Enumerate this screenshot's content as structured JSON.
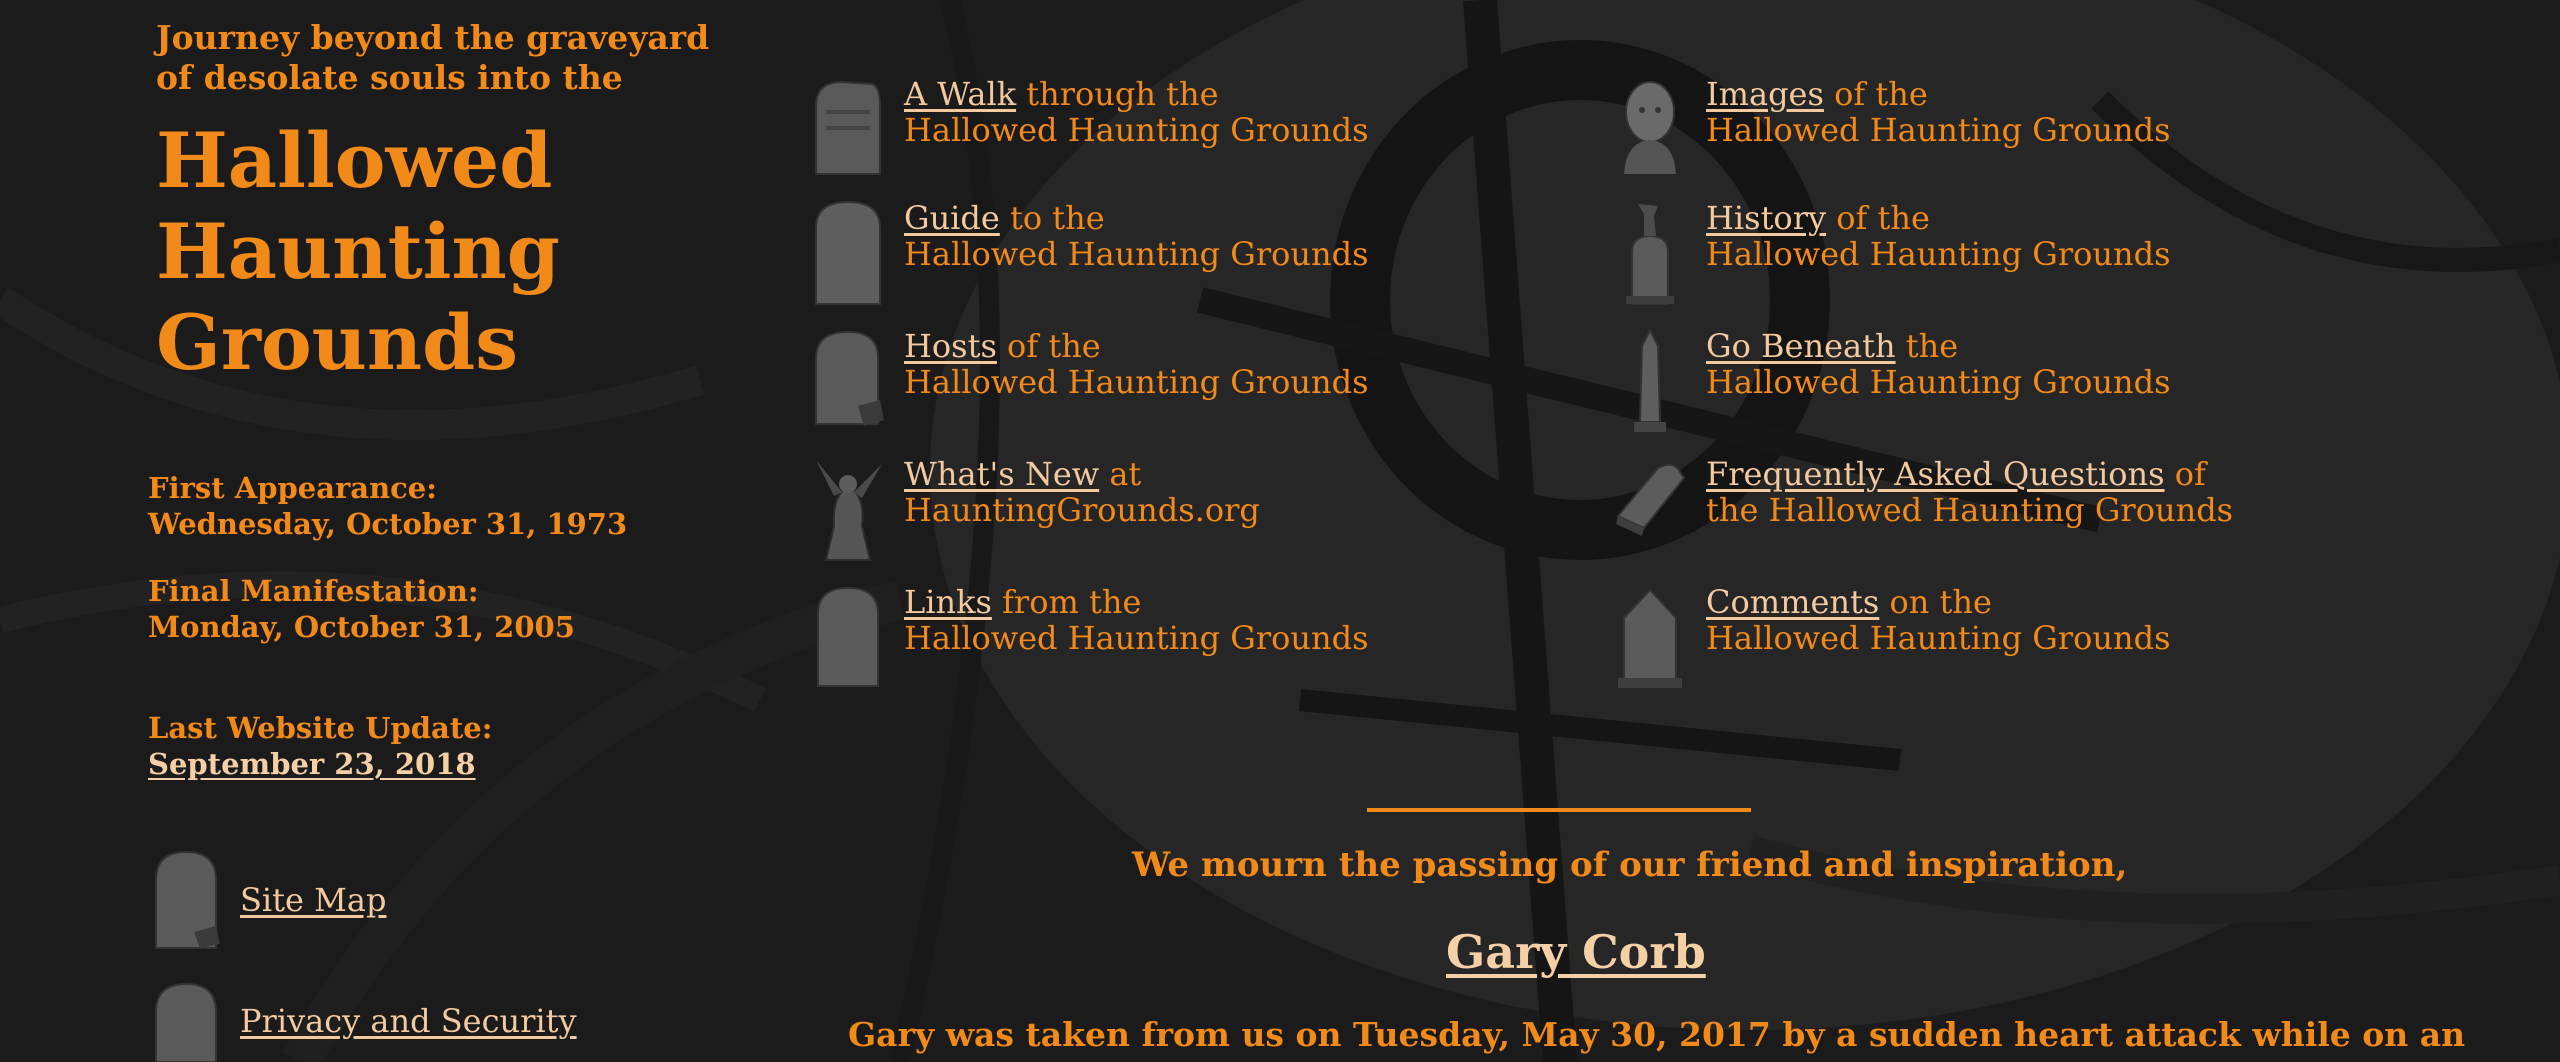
{
  "intro": {
    "line1": "Journey beyond the graveyard",
    "line2": "of desolate souls into the"
  },
  "title": {
    "line1": "Hallowed",
    "line2": "Haunting",
    "line3": "Grounds"
  },
  "dates": {
    "first_label": "First Appearance:",
    "first_value": "Wednesday, October 31, 1973",
    "final_label": "Final Manifestation:",
    "final_value": "Monday, October 31, 2005",
    "update_label": "Last Website Update:",
    "update_value": "September 23, 2018"
  },
  "side_links": {
    "sitemap": "Site Map",
    "privacy": "Privacy and Security"
  },
  "nav": {
    "walk": {
      "link": "A Walk",
      "rest": " through the",
      "line2": "Hallowed Haunting Grounds"
    },
    "guide": {
      "link": "Guide",
      "rest": " to the",
      "line2": "Hallowed Haunting Grounds"
    },
    "hosts": {
      "link": "Hosts",
      "rest": " of the",
      "line2": "Hallowed Haunting Grounds"
    },
    "whatsnew": {
      "link": "What's New",
      "rest": " at",
      "line2": "HauntingGrounds.org"
    },
    "links": {
      "link": "Links",
      "rest": " from the",
      "line2": "Hallowed Haunting Grounds"
    },
    "images": {
      "link": "Images",
      "rest": " of the",
      "line2": "Hallowed Haunting Grounds"
    },
    "history": {
      "link": "History",
      "rest": " of the",
      "line2": "Hallowed Haunting Grounds"
    },
    "beneath": {
      "link": "Go Beneath",
      "rest": " the",
      "line2": "Hallowed Haunting Grounds"
    },
    "faq": {
      "link": "Frequently Asked Questions",
      "rest": " of",
      "line2": "the Hallowed Haunting Grounds"
    },
    "comments": {
      "link": "Comments",
      "rest": " on the",
      "line2": "Hallowed Haunting Grounds"
    }
  },
  "memorial": {
    "mourn": "We mourn the passing of our friend and inspiration,",
    "name": "Gary Corb",
    "passed": "Gary was taken from us on Tuesday, May 30, 2017 by a sudden heart attack while on an"
  },
  "icons": {
    "walk": "tombstone-icon",
    "guide": "tombstone-icon",
    "hosts": "tombstone-icon",
    "whatsnew": "gargoyle-icon",
    "links": "tombstone-icon",
    "images": "bust-icon",
    "history": "statue-tombstone-icon",
    "beneath": "obelisk-icon",
    "faq": "fallen-stone-icon",
    "comments": "tombstone-icon"
  },
  "colors": {
    "background": "#1b1b1b",
    "text": "#f28a1a",
    "link": "#f3c9a0"
  }
}
